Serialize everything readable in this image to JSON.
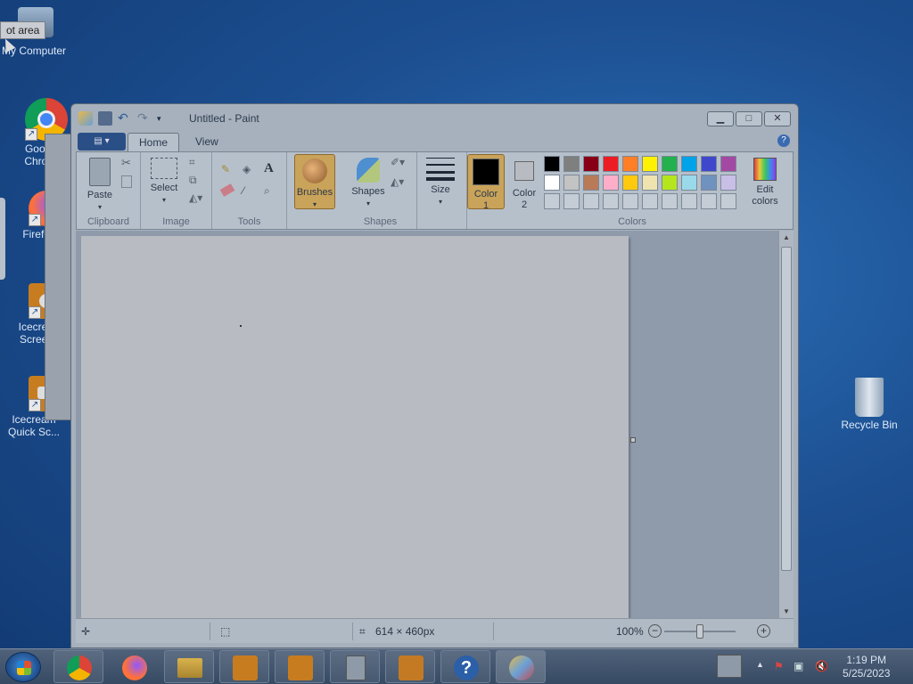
{
  "desktop": {
    "icons": [
      {
        "label": "My Computer"
      },
      {
        "label": "Google Chrome",
        "short": "Googl Chron"
      },
      {
        "label": "Firefox",
        "short": "Firefo"
      },
      {
        "label": "Icecream Screen",
        "short": "Icecrea Screen"
      },
      {
        "label": "Icecream Quick Sc...",
        "short": "Icecream Quick Sc..."
      },
      {
        "label": "Recycle Bin"
      }
    ],
    "tooltip": "ot area"
  },
  "paint": {
    "title": "Untitled - Paint",
    "tabs": [
      {
        "label": "Home"
      },
      {
        "label": "View"
      }
    ],
    "ribbon": {
      "clipboard": {
        "group_label": "Clipboard",
        "paste": "Paste"
      },
      "image": {
        "group_label": "Image",
        "select": "Select"
      },
      "tools": {
        "group_label": "Tools"
      },
      "brushes": {
        "label": "Brushes"
      },
      "shapes": {
        "group_label": "Shapes",
        "label": "Shapes"
      },
      "size": {
        "label": "Size"
      },
      "colors": {
        "group_label": "Colors",
        "color1": "Color",
        "color1_num": "1",
        "color2": "Color",
        "color2_num": "2",
        "edit": "Edit",
        "edit2": "colors",
        "palette_row1": [
          "#000000",
          "#7f7f7f",
          "#880015",
          "#ed1c24",
          "#ff7f27",
          "#fff200",
          "#22b14c",
          "#00a2e8",
          "#3f48cc",
          "#a349a4"
        ],
        "palette_row2": [
          "#ffffff",
          "#c3c3c3",
          "#b97a57",
          "#ffaec9",
          "#ffc90e",
          "#efe4b0",
          "#b5e61d",
          "#99d9ea",
          "#7092be",
          "#c8bfe7"
        ]
      }
    },
    "status": {
      "size": "614 × 460px",
      "zoom": "100%"
    }
  },
  "taskbar": {
    "time": "1:19 PM",
    "date": "5/25/2023"
  }
}
